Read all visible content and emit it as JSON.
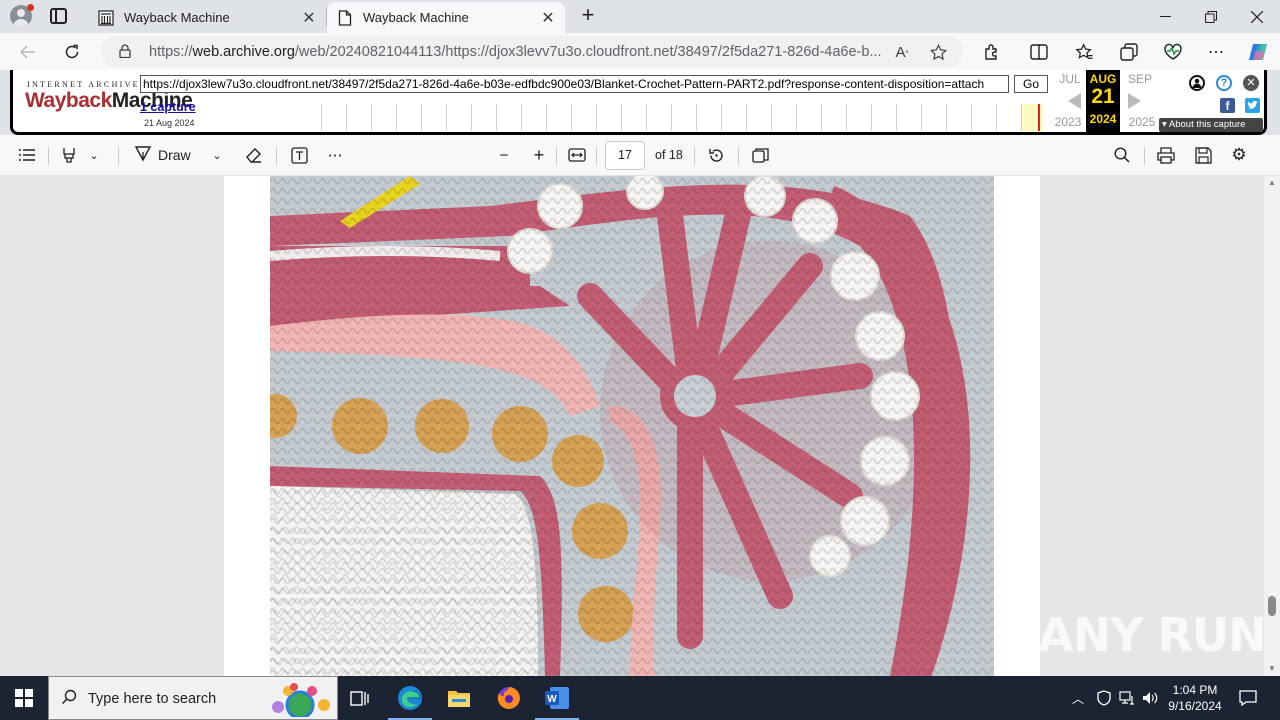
{
  "browser": {
    "tabs": [
      {
        "label": "Wayback Machine",
        "active": false
      },
      {
        "label": "Wayback Machine",
        "active": true
      }
    ],
    "address": {
      "scheme": "https://",
      "host": "web.archive.org",
      "path": "/web/20240821044113/https://djox3levv7u3o.cloudfront.net/38497/2f5da271-826d-4a6e-b..."
    }
  },
  "wayback": {
    "logo_top": "INTERNET ARCHIVE",
    "logo_part1": "Wayback",
    "logo_part2": "Machine",
    "url_value": "https://djox3lew7u3o.cloudfront.net/38497/2f5da271-826d-4a6e-b03e-edfbdc900e03/Blanket-Crochet-Pattern-PART2.pdf?response-content-disposition=attach",
    "go_label": "Go",
    "captures_label": "1 capture",
    "captures_date": "21 Aug 2024",
    "prev_month": "JUL",
    "cur_month": "AUG",
    "next_month": "SEP",
    "cur_day": "21",
    "prev_year": "2023",
    "cur_year": "2024",
    "next_year": "2025",
    "about_label": "About this capture"
  },
  "pdf_toolbar": {
    "draw_label": "Draw",
    "page_current": "17",
    "page_total_label": "of 18"
  },
  "watermark": "ANY RUN",
  "taskbar": {
    "search_placeholder": "Type here to search",
    "time": "1:04 PM",
    "date": "9/16/2024"
  },
  "colors": {
    "wayback_red": "#ab2e33",
    "calendar_gold": "#ffd700",
    "capture_red": "#e02020",
    "link_blue": "#1a0dab"
  },
  "icons": [
    "profile-icon",
    "tab-actions-icon",
    "wayback-favicon",
    "document-favicon",
    "close-icon",
    "plus-icon",
    "minimize-icon",
    "maximize-icon",
    "back-icon",
    "refresh-icon",
    "lock-icon",
    "read-aloud-icon",
    "favorite-star-icon",
    "extensions-icon",
    "split-screen-icon",
    "favorites-icon",
    "collections-icon",
    "performance-icon",
    "more-icon",
    "copilot-icon",
    "user-account-icon",
    "help-icon",
    "wayback-close-icon",
    "facebook-icon",
    "twitter-icon",
    "contents-icon",
    "highlight-icon",
    "draw-icon",
    "erase-icon",
    "text-icon",
    "zoom-out-icon",
    "zoom-in-icon",
    "fit-icon",
    "rotate-icon",
    "page-view-icon",
    "search-icon",
    "print-icon",
    "save-icon",
    "settings-icon",
    "windows-start-icon",
    "task-view-icon",
    "edge-icon",
    "file-explorer-icon",
    "firefox-icon",
    "word-icon"
  ]
}
